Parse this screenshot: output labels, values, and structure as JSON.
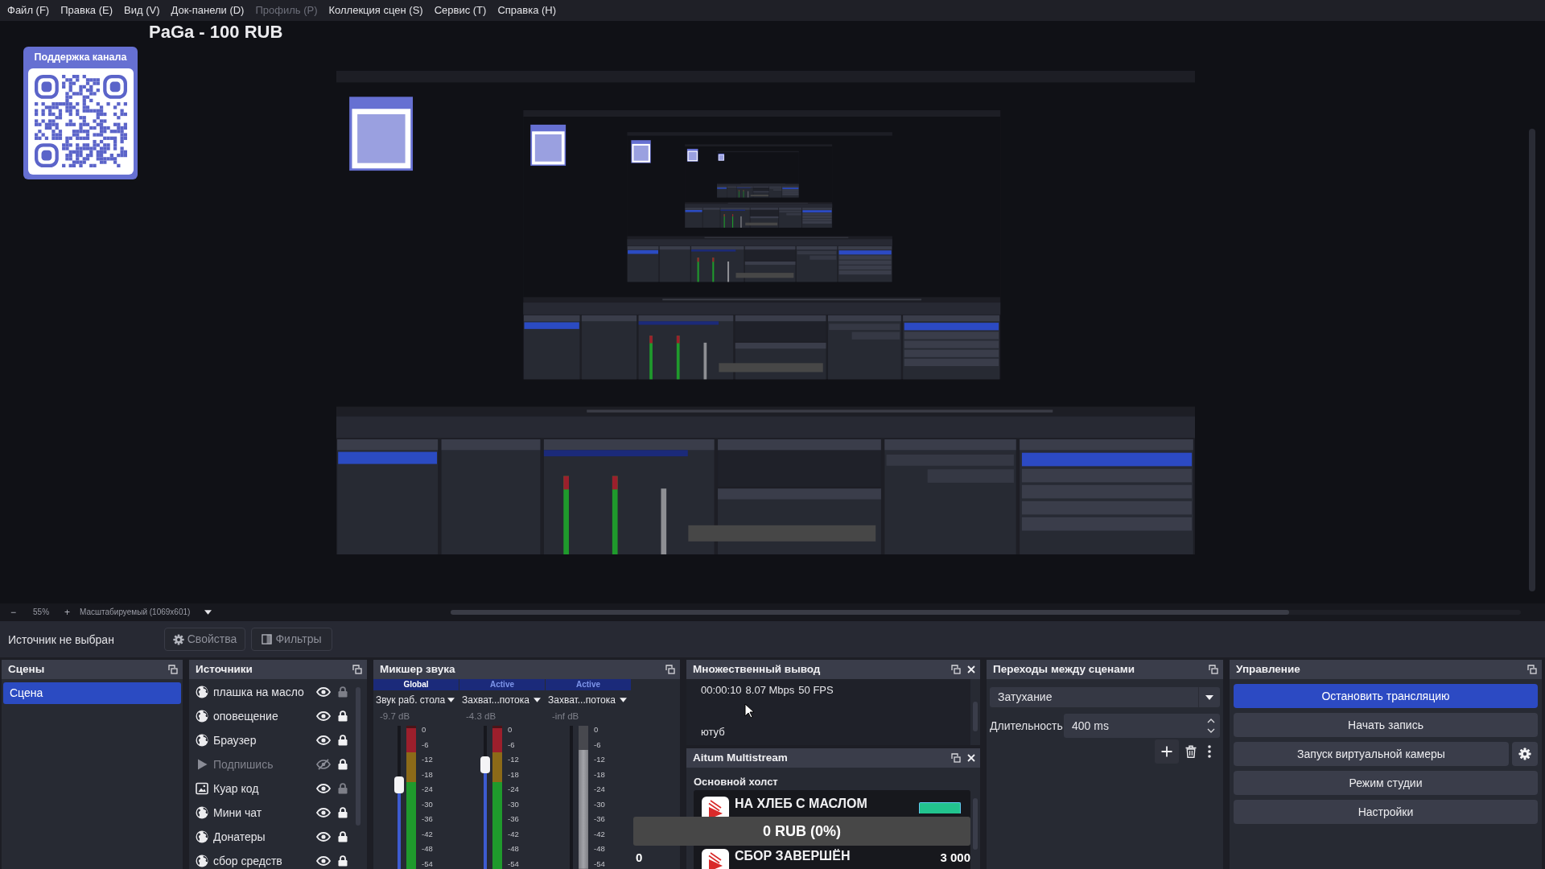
{
  "menu": [
    {
      "label": "Файл (F)",
      "disabled": false
    },
    {
      "label": "Правка (E)",
      "disabled": false
    },
    {
      "label": "Вид (V)",
      "disabled": false
    },
    {
      "label": "Док-панели (D)",
      "disabled": false
    },
    {
      "label": "Профиль (P)",
      "disabled": true
    },
    {
      "label": "Коллекция сцен (S)",
      "disabled": false
    },
    {
      "label": "Сервис (T)",
      "disabled": false
    },
    {
      "label": "Справка (H)",
      "disabled": false
    }
  ],
  "preview": {
    "title_text": "PaGa - 100 RUB",
    "qr_card": {
      "title": "Поддержка канала"
    }
  },
  "zoom_bar": {
    "zoom_out": "−",
    "zoom": "55%",
    "zoom_in": "+",
    "scale_mode": "Масштабируемый (1069x601)"
  },
  "context_bar": {
    "status": "Источник не выбран",
    "buttons": [
      {
        "kind": "properties",
        "label": "Свойства",
        "disabled": true
      },
      {
        "kind": "filters",
        "label": "Фильтры",
        "disabled": true
      }
    ]
  },
  "scenes_dock": {
    "title": "Сцены",
    "closable": false,
    "scenes": [
      {
        "name": "Сцена",
        "selected": true
      }
    ]
  },
  "sources_dock": {
    "title": "Источники",
    "closable": false,
    "sources": [
      {
        "name": "плашка на масло",
        "kind": "browser",
        "visible": true,
        "locked": false
      },
      {
        "name": "оповещение",
        "kind": "browser",
        "visible": true,
        "locked": true
      },
      {
        "name": "Браузер",
        "kind": "browser",
        "visible": true,
        "locked": true
      },
      {
        "name": "Подпишись",
        "kind": "media",
        "visible": false,
        "locked": true
      },
      {
        "name": "Куар код",
        "kind": "image",
        "visible": true,
        "locked": false
      },
      {
        "name": "Мини чат",
        "kind": "browser",
        "visible": true,
        "locked": true
      },
      {
        "name": "Донатеры",
        "kind": "browser",
        "visible": true,
        "locked": true
      },
      {
        "name": "сбор средств",
        "kind": "browser",
        "visible": true,
        "locked": true
      }
    ]
  },
  "mixer_dock": {
    "title": "Микшер звука",
    "closable": false,
    "channels": [
      {
        "kind": "global",
        "status": "Global",
        "name": "Звук раб. стола",
        "reading": "-9.7 dB",
        "muted": false,
        "fader": {
          "level": 0.59
        },
        "meter": {
          "level": 1
        },
        "scale": [
          "0",
          "-6",
          "-12",
          "-18",
          "-24",
          "-30",
          "-36",
          "-42",
          "-48",
          "-54"
        ]
      },
      {
        "kind": "active",
        "status": "Active",
        "name": "Захват...потока",
        "reading": "-4.3 dB",
        "muted": false,
        "fader": {
          "level": 0.73
        },
        "meter": {
          "level": 1
        },
        "scale": [
          "0",
          "-6",
          "-12",
          "-18",
          "-24",
          "-30",
          "-36",
          "-42",
          "-48",
          "-54"
        ]
      },
      {
        "kind": "active",
        "status": "Active",
        "name": "Захват...потока",
        "reading": "-inf dB",
        "muted": true,
        "meter": {
          "level": 0.83
        },
        "scale": [
          "0",
          "-6",
          "-12",
          "-18",
          "-24",
          "-30",
          "-36",
          "-42",
          "-48",
          "-54"
        ]
      }
    ]
  },
  "multi_output_dock": {
    "title": "Множественный вывод",
    "closable": true,
    "stats": [
      "00:00:10",
      "8.07 Mbps",
      "50 FPS"
    ],
    "outputs": [
      "ютуб"
    ]
  },
  "aitum_dock": {
    "title": "Aitum Multistream",
    "closable": true,
    "section": "Основной холст",
    "items": [
      {
        "title": "НА ХЛЕБ С МАСЛОМ",
        "has_toggle": true
      },
      {
        "title": "СБОР ЗАВЕРШЁН",
        "has_toggle": false
      }
    ]
  },
  "transitions_dock": {
    "title": "Переходы между сценами",
    "closable": false,
    "transition": "Затухание",
    "duration_label": "Длительность",
    "duration": "400 ms"
  },
  "controls_dock": {
    "title": "Управление",
    "closable": false,
    "buttons": [
      {
        "label": "Остановить трансляцию",
        "active": true,
        "has_settings": false
      },
      {
        "label": "Начать запись",
        "active": false,
        "has_settings": false
      },
      {
        "label": "Запуск виртуальной камеры",
        "active": false,
        "has_settings": true
      },
      {
        "label": "Режим студии",
        "active": false,
        "has_settings": false
      },
      {
        "label": "Настройки",
        "active": false,
        "has_settings": false
      }
    ]
  },
  "goal_widget": {
    "label": "0 RUB (0%)",
    "level": 0,
    "start": "0",
    "end": "3 000"
  }
}
